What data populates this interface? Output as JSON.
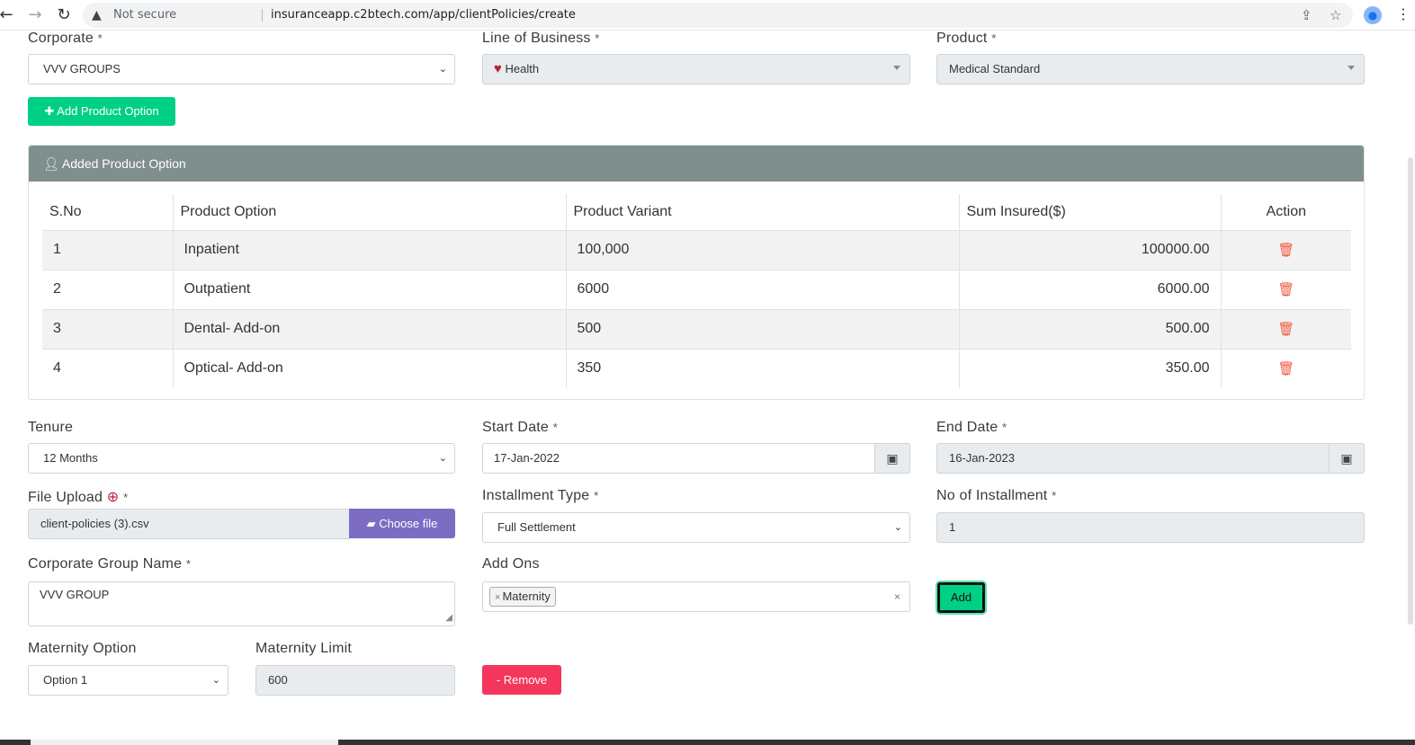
{
  "browser": {
    "security": "Not secure",
    "url": "insuranceapp.c2btech.com/app/clientPolicies/create"
  },
  "form": {
    "corporate": {
      "label": "Corporate",
      "value": "VVV GROUPS"
    },
    "line_of_business": {
      "label": "Line of Business",
      "value": "Health"
    },
    "product": {
      "label": "Product",
      "value": "Medical Standard"
    },
    "add_product_option": "Add Product Option",
    "tenure": {
      "label": "Tenure",
      "value": "12 Months"
    },
    "start_date": {
      "label": "Start Date",
      "value": "17-Jan-2022"
    },
    "end_date": {
      "label": "End Date",
      "value": "16-Jan-2023"
    },
    "file_upload": {
      "label": "File Upload",
      "value": "client-policies (3).csv",
      "button": "Choose file"
    },
    "installment_type": {
      "label": "Installment Type",
      "value": "Full Settlement"
    },
    "no_of_installment": {
      "label": "No of Installment",
      "value": "1"
    },
    "corporate_group_name": {
      "label": "Corporate Group Name",
      "value": "VVV GROUP"
    },
    "add_ons": {
      "label": "Add Ons",
      "tag": "Maternity"
    },
    "add_button": "Add",
    "maternity_option": {
      "label": "Maternity Option",
      "value": "Option 1"
    },
    "maternity_limit": {
      "label": "Maternity Limit",
      "value": "600"
    },
    "remove_button": "- Remove",
    "required_mark": "*"
  },
  "product_table": {
    "title": "Added Product Option",
    "headers": [
      "S.No",
      "Product Option",
      "Product Variant",
      "Sum Insured($)",
      "Action"
    ],
    "rows": [
      [
        "1",
        "Inpatient",
        "100,000",
        "100000.00"
      ],
      [
        "2",
        "Outpatient",
        "6000",
        "6000.00"
      ],
      [
        "3",
        "Dental- Add-on",
        "500",
        "500.00"
      ],
      [
        "4",
        "Optical- Add-on",
        "350",
        "350.00"
      ]
    ]
  },
  "colors": {
    "green": "#00d084",
    "purple": "#7c6cc4",
    "red": "#f5365c",
    "card_header": "#7f8f8e",
    "trash": "#f05a3e"
  }
}
